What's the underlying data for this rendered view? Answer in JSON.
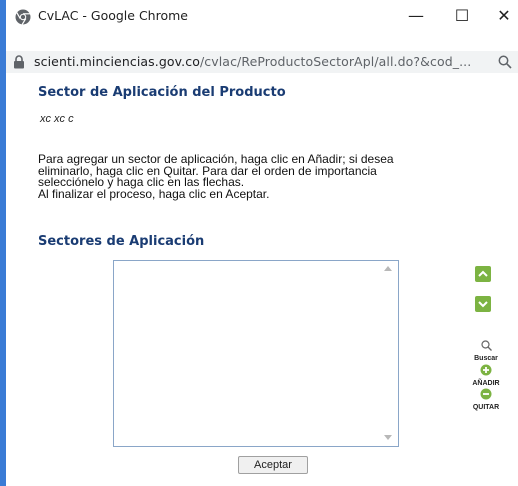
{
  "window": {
    "title": "CvLAC - Google Chrome",
    "minimize": "—",
    "maximize": "☐",
    "close": "✕"
  },
  "address": {
    "host": "scienti.minciencias.gov.co",
    "path": "/cvlac/ReProductoSectorApl/all.do?&cod_...",
    "icon": "zoom-icon"
  },
  "page": {
    "section_title": "Sector de Aplicación del Producto",
    "product_name": "xc xc c",
    "instructions": [
      "Para agregar un sector de aplicación, haga clic en Añadir; si desea",
      "eliminarlo, haga clic en Quitar. Para dar el orden de importancia",
      "selecciónelo y haga clic en las flechas.",
      "Al finalizar el proceso, haga clic en Aceptar."
    ],
    "sectors_title": "Sectores de Aplicación",
    "sectors": [],
    "tools": {
      "search": "Buscar",
      "add": "AÑADIR",
      "remove": "QUITAR"
    },
    "accept_label": "Aceptar"
  },
  "colors": {
    "heading": "#1a3c73",
    "accent_green": "#7cb342",
    "window_border": "#3a7bd5"
  }
}
